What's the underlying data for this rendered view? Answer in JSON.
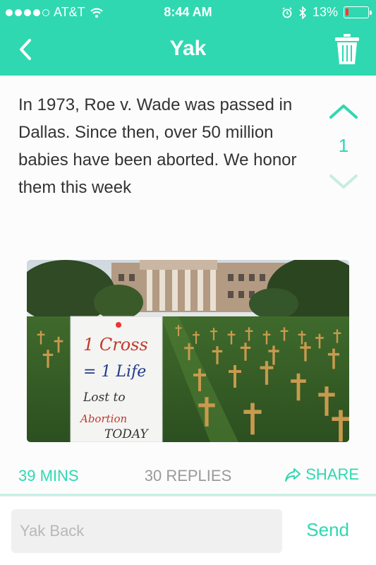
{
  "status_bar": {
    "carrier": "AT&T",
    "time": "8:44 AM",
    "battery_percent_label": "13%",
    "battery_level": 0.13,
    "signal_bars": 4,
    "icons": [
      "wifi-icon",
      "alarm-icon",
      "bluetooth-icon",
      "battery-icon"
    ]
  },
  "nav": {
    "title": "Yak",
    "back_icon": "chevron-left-icon",
    "trash_icon": "trash-icon"
  },
  "post": {
    "text": "In 1973, Roe v. Wade was passed in Dallas. Since then, over 50 million babies have been aborted. We honor them this week",
    "vote_count": "1",
    "image": {
      "sign_lines": [
        "1 Cross",
        "= 1 Life",
        "Lost to",
        "Abortion",
        "TODAY"
      ]
    }
  },
  "meta": {
    "time": "39 MINS",
    "replies": "30 REPLIES",
    "share": "SHARE"
  },
  "reply": {
    "placeholder": "Yak Back",
    "send": "Send"
  },
  "colors": {
    "accent": "#2fd8b1",
    "battery_low": "#ff3b30",
    "muted": "#9a9a9a"
  }
}
